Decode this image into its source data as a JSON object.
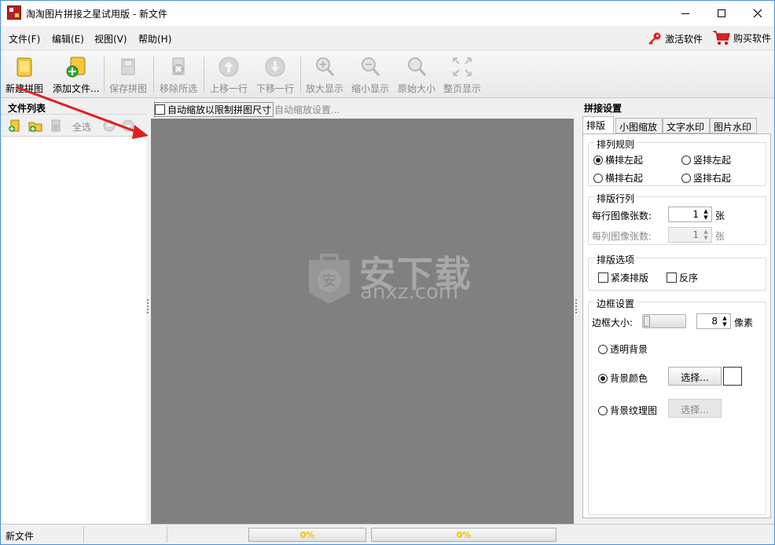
{
  "window": {
    "title": "淘淘图片拼接之星试用版 - 新文件"
  },
  "menu": {
    "file": "文件(F)",
    "edit": "编辑(E)",
    "view": "视图(V)",
    "help": "帮助(H)",
    "activate": "激活软件",
    "buy": "购买软件"
  },
  "toolbar": {
    "new_puzzle": "新建拼图",
    "add_file": "添加文件...",
    "save_puzzle": "保存拼图",
    "remove_selected": "移除所选",
    "move_up": "上移一行",
    "move_down": "下移一行",
    "zoom_in": "放大显示",
    "zoom_out": "缩小显示",
    "original_size": "原始大小",
    "fit_page": "整页显示"
  },
  "left_panel": {
    "title": "文件列表",
    "select_all": "全选"
  },
  "canvas": {
    "auto_fit_label": "自动缩放以限制拼图尺寸",
    "auto_fit_checked": false,
    "auto_fit_settings": "自动缩放设置...",
    "watermark_cn": "安下载",
    "watermark_en": "anxz.com",
    "watermark_glyph": "安",
    "background": "#808080"
  },
  "right_panel": {
    "title": "拼接设置",
    "tabs": [
      "排版",
      "小图缩放",
      "文字水印",
      "图片水印"
    ],
    "active_tab": 0,
    "arrangement": {
      "title": "排列规则",
      "options": [
        "横排左起",
        "竖排左起",
        "横排右起",
        "竖排右起"
      ],
      "selected": 0
    },
    "rows_cols": {
      "title": "排版行列",
      "per_row_label": "每行图像张数:",
      "per_row_value": "1",
      "per_row_unit": "张",
      "per_col_label": "每列图像张数:",
      "per_col_value": "1",
      "per_col_unit": "张"
    },
    "layout_options": {
      "title": "排版选项",
      "compact": "紧凑排版",
      "reverse": "反序"
    },
    "border": {
      "title": "边框设置",
      "size_label": "边框大小:",
      "size_value": "8",
      "size_unit": "像素",
      "transparent_bg": "透明背景",
      "bg_color": "背景颜色",
      "bg_texture": "背景纹理图",
      "choose": "选择...",
      "choose_disabled": "选择...",
      "selected": 1,
      "bg_color_value": "#ffffff"
    }
  },
  "status": {
    "text": "新文件",
    "progress1": "0%",
    "progress2": "0%"
  },
  "colors": {
    "accent_red": "#e0201f",
    "canvas_gray": "#808080",
    "progress_text": "#f0c000"
  }
}
